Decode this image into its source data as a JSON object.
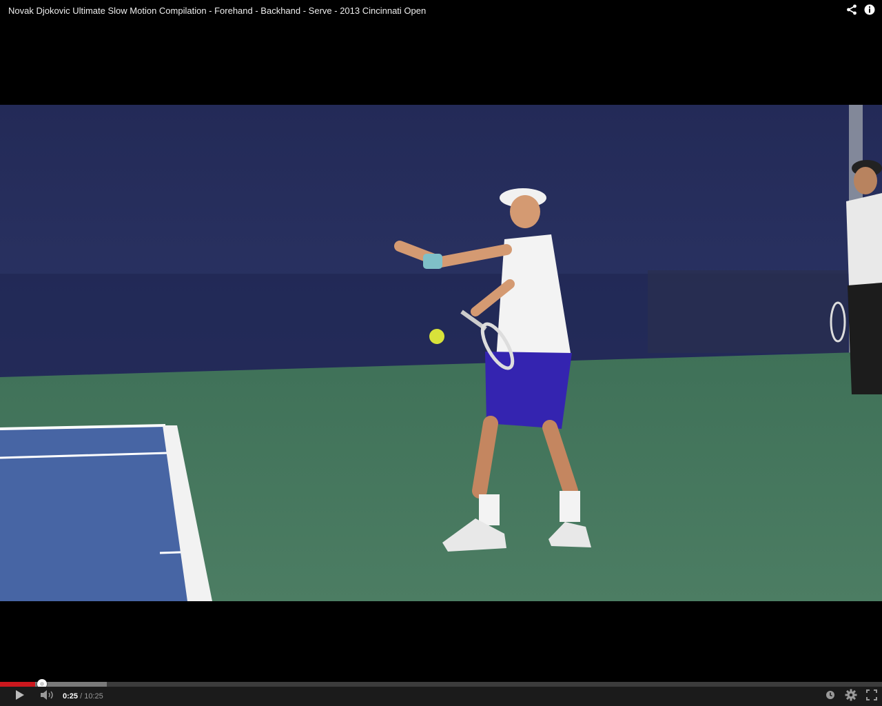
{
  "player": {
    "title": "Novak Djokovic Ultimate Slow Motion Compilation - Forehand - Backhand - Serve - 2013 Cincinnati Open",
    "current_time": "0:25",
    "separator": "/",
    "duration": "10:25",
    "progress_fraction": 0.04,
    "buffered_fraction": 0.121
  },
  "icons": {
    "share": "share-icon",
    "info": "info-icon",
    "play": "play-icon",
    "volume": "volume-icon",
    "watch_later": "watch-later-icon",
    "settings": "gear-icon",
    "fullscreen": "fullscreen-icon"
  },
  "colors": {
    "played": "#cc181e",
    "buffered": "#7a7a7a",
    "track": "#3c3c3c",
    "controls_bg": "#1b1b1b"
  }
}
